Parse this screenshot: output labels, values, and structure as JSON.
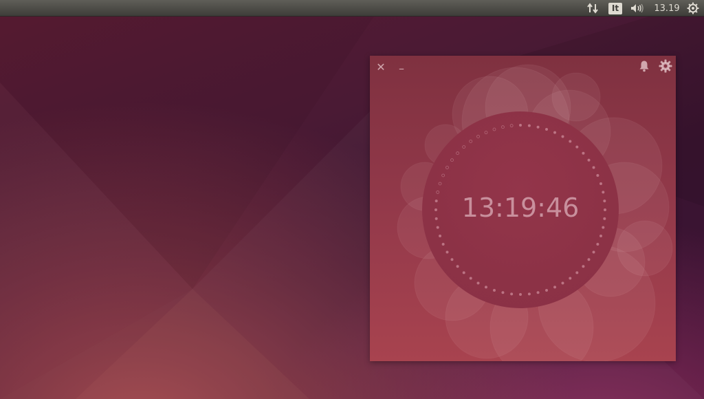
{
  "panel": {
    "keyboard_layout": "It",
    "clock": "13.19",
    "icons": {
      "network": "network-transfer-icon",
      "sound": "speaker-volume-icon",
      "session": "gear-power-icon"
    }
  },
  "clock_app": {
    "time": "13:19:46",
    "close_glyph": "✕",
    "minimize_glyph": "–",
    "icons": {
      "alarm": "bell-icon",
      "settings": "gear-icon"
    },
    "colors": {
      "window": "#93394a",
      "dial": "#8c3246",
      "text": "#d2a0ac"
    },
    "seconds_elapsed": 46
  },
  "colors": {
    "panel": "#3e3d39",
    "wallpaper_dark": "#3a1430",
    "wallpaper_warm": "#a0434a"
  }
}
